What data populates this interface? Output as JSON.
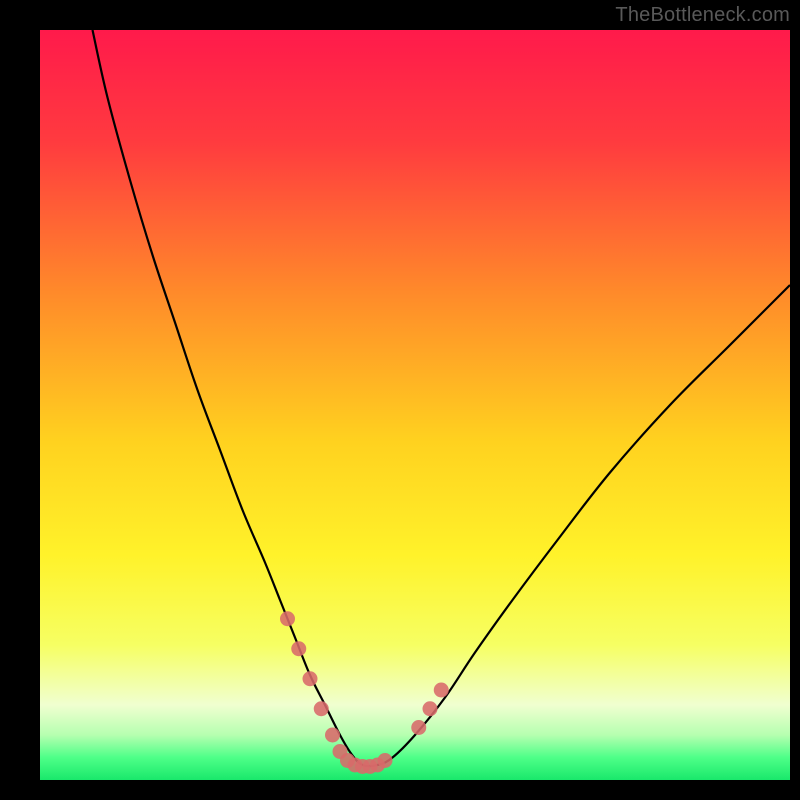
{
  "watermark": "TheBottleneck.com",
  "colors": {
    "black": "#000000",
    "curve": "#000000",
    "marker": "#d86a6a",
    "markerStroke": "#d86a6a",
    "watermark": "#595959"
  },
  "chart_data": {
    "type": "line",
    "title": "",
    "xlabel": "",
    "ylabel": "",
    "xlim": [
      0,
      100
    ],
    "ylim": [
      0,
      100
    ],
    "grid": false,
    "legend": false,
    "gradient_stops": [
      {
        "pct": 0,
        "color": "#ff1a4b"
      },
      {
        "pct": 15,
        "color": "#ff3b3f"
      },
      {
        "pct": 35,
        "color": "#ff8a2a"
      },
      {
        "pct": 55,
        "color": "#ffd21f"
      },
      {
        "pct": 70,
        "color": "#fff22a"
      },
      {
        "pct": 82,
        "color": "#f6ff63"
      },
      {
        "pct": 90,
        "color": "#f0ffd0"
      },
      {
        "pct": 94,
        "color": "#b6ffb0"
      },
      {
        "pct": 97,
        "color": "#4eff88"
      },
      {
        "pct": 100,
        "color": "#19e86b"
      }
    ],
    "series": [
      {
        "name": "bottleneck-curve",
        "x": [
          7,
          9,
          12,
          15,
          18,
          21,
          24,
          27,
          30,
          32,
          34,
          36,
          38,
          40,
          41.5,
          43,
          45,
          47,
          50,
          54,
          58,
          63,
          69,
          76,
          84,
          92,
          100
        ],
        "y": [
          100,
          91,
          80,
          70,
          61,
          52,
          44,
          36,
          29,
          24,
          19,
          14,
          10,
          6,
          3.5,
          2,
          2,
          3,
          6,
          11,
          17,
          24,
          32,
          41,
          50,
          58,
          66
        ]
      }
    ],
    "markers": [
      {
        "x": 33.0,
        "y": 21.5
      },
      {
        "x": 34.5,
        "y": 17.5
      },
      {
        "x": 36.0,
        "y": 13.5
      },
      {
        "x": 37.5,
        "y": 9.5
      },
      {
        "x": 39.0,
        "y": 6.0
      },
      {
        "x": 40.0,
        "y": 3.8
      },
      {
        "x": 41.0,
        "y": 2.6
      },
      {
        "x": 42.0,
        "y": 2.0
      },
      {
        "x": 43.0,
        "y": 1.8
      },
      {
        "x": 44.0,
        "y": 1.8
      },
      {
        "x": 45.0,
        "y": 2.0
      },
      {
        "x": 46.0,
        "y": 2.6
      },
      {
        "x": 50.5,
        "y": 7.0
      },
      {
        "x": 52.0,
        "y": 9.5
      },
      {
        "x": 53.5,
        "y": 12.0
      }
    ],
    "marker_radius": 7.5
  }
}
